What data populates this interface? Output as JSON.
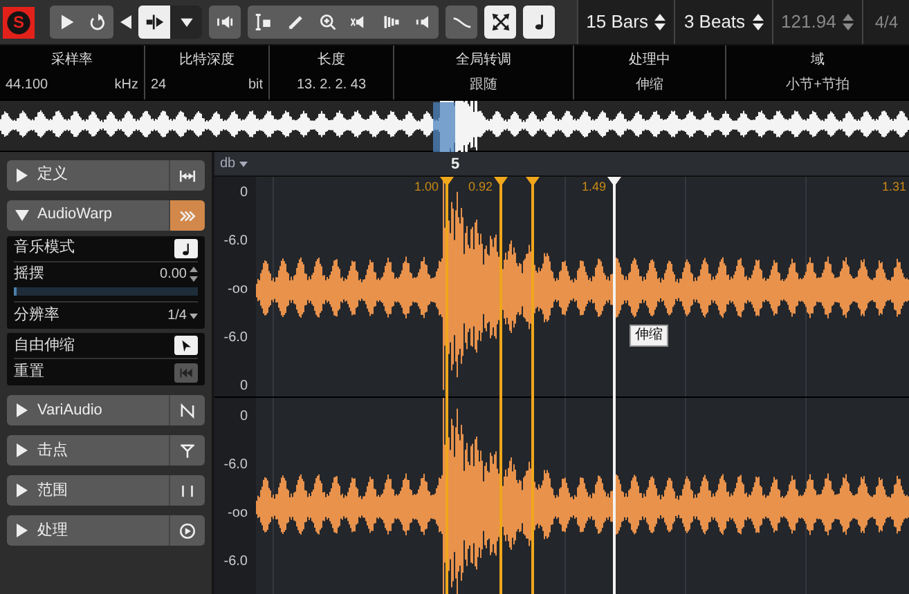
{
  "toolbar": {
    "logo": "S",
    "groups": [
      [
        {
          "selected": false
        },
        {
          "selected": false
        }
      ],
      [
        {
          "selected": true
        },
        {
          "selected": false
        }
      ],
      [
        {
          "selected": false
        }
      ],
      [
        {
          "selected": false
        },
        {
          "selected": false
        },
        {
          "selected": false
        },
        {
          "selected": false
        },
        {
          "selected": false
        },
        {
          "selected": false
        }
      ],
      [
        {
          "selected": false
        }
      ],
      [
        {
          "selected": true
        }
      ],
      [
        {
          "selected": true
        }
      ]
    ],
    "spinners": [
      {
        "value": "15 Bars",
        "disabled": false
      },
      {
        "value": "3 Beats",
        "disabled": false
      },
      {
        "value": "121.94",
        "disabled": true
      }
    ],
    "signature": "4/4"
  },
  "info_bar": [
    {
      "label": "采样率",
      "value": "44.100",
      "unit": "kHz"
    },
    {
      "label": "比特深度",
      "value": "24",
      "unit": "bit"
    },
    {
      "label": "长度",
      "value": "13. 2. 2. 43"
    },
    {
      "label": "全局转调",
      "value": "跟随"
    },
    {
      "label": "处理中",
      "value": "伸缩"
    },
    {
      "label": "域",
      "value": "小节+节拍"
    }
  ],
  "inspector": [
    {
      "title": "定义",
      "expanded": false,
      "active": false
    },
    {
      "title": "AudioWarp",
      "expanded": true,
      "active": true,
      "groups": [
        [
          {
            "kind": "toggle",
            "label": "音乐模式",
            "on": true
          },
          {
            "kind": "slider",
            "label": "摇摆",
            "value": "0.00",
            "level": 0
          },
          {
            "kind": "dropdown",
            "label": "分辨率",
            "value": "1/4"
          }
        ],
        [
          {
            "kind": "toggle",
            "label": "自由伸缩",
            "on": true
          },
          {
            "kind": "button",
            "label": "重置"
          }
        ]
      ]
    },
    {
      "title": "VariAudio",
      "expanded": false,
      "active": false
    },
    {
      "title": "击点",
      "expanded": false,
      "active": false
    },
    {
      "title": "范围",
      "expanded": false,
      "active": false
    },
    {
      "title": "处理",
      "expanded": false,
      "active": false
    }
  ],
  "editor": {
    "unit": "db",
    "ruler_label": "5",
    "channels": [
      {
        "scale": [
          "0",
          "-6.0",
          "-oo",
          "-6.0",
          "0"
        ]
      },
      {
        "scale": [
          "0",
          "-6.0",
          "-oo",
          "-6.0"
        ]
      }
    ],
    "warp_markers": [
      {
        "label": "1.00",
        "selected": false
      },
      {
        "label": "0.92",
        "selected": false
      },
      {
        "selected": false
      },
      {
        "label": "1.49",
        "selected": true
      }
    ],
    "edge_label": "1.31",
    "tooltip": "伸缩"
  }
}
